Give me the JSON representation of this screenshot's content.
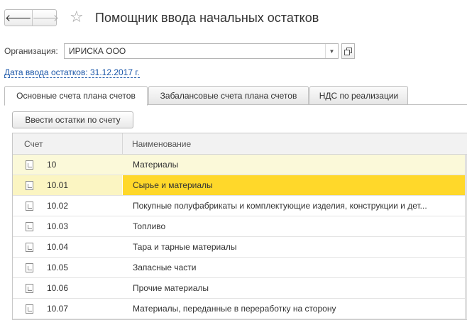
{
  "nav": {
    "back": "🡐",
    "forward": "🡒"
  },
  "window": {
    "title": "Помощник ввода начальных остатков"
  },
  "organization": {
    "label": "Организация:",
    "value": "ИРИСКА ООО"
  },
  "date_link": "Дата ввода остатков: 31.12.2017 г.",
  "tabs": [
    {
      "label": "Основные счета плана счетов",
      "active": true
    },
    {
      "label": "Забалансовые счета плана счетов",
      "active": false
    },
    {
      "label": "НДС по реализации",
      "active": false
    }
  ],
  "enter_button": "Ввести остатки по счету",
  "table": {
    "columns": [
      "Счет",
      "Наименование"
    ],
    "rows": [
      {
        "code": "10",
        "name": "Материалы"
      },
      {
        "code": "10.01",
        "name": "Сырье и материалы"
      },
      {
        "code": "10.02",
        "name": "Покупные полуфабрикаты и комплектующие изделия, конструкции и дет..."
      },
      {
        "code": "10.03",
        "name": "Топливо"
      },
      {
        "code": "10.04",
        "name": "Тара и тарные материалы"
      },
      {
        "code": "10.05",
        "name": "Запасные части"
      },
      {
        "code": "10.06",
        "name": "Прочие материалы"
      },
      {
        "code": "10.07",
        "name": "Материалы, переданные в переработку на сторону"
      }
    ]
  },
  "colors": {
    "selection": "#ffd82a",
    "row_highlight": "#fbf9d9",
    "link": "#1a56a8"
  }
}
